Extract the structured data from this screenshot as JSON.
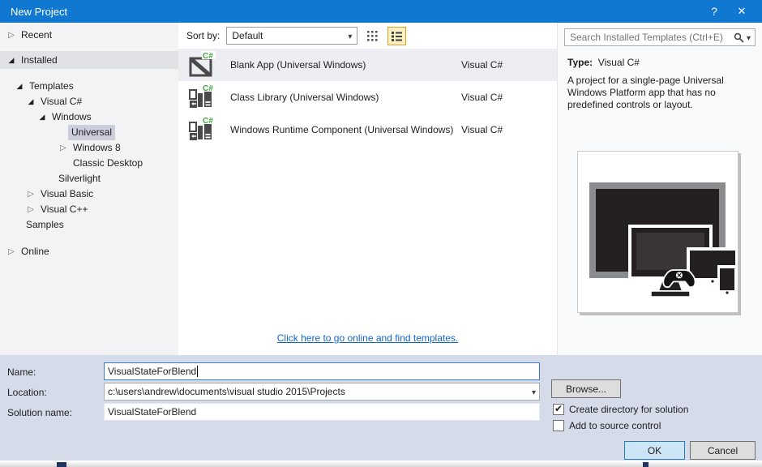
{
  "titlebar": {
    "title": "New Project",
    "help": "?",
    "close": "✕"
  },
  "sidebar": {
    "tree": [
      {
        "label": "Recent"
      },
      {
        "label": "Installed"
      },
      {
        "label": "Templates"
      },
      {
        "label": "Visual C#"
      },
      {
        "label": "Windows"
      },
      {
        "label": "Universal"
      },
      {
        "label": "Windows 8"
      },
      {
        "label": "Classic Desktop"
      },
      {
        "label": "Silverlight"
      },
      {
        "label": "Visual Basic"
      },
      {
        "label": "Visual C++"
      },
      {
        "label": "Samples"
      },
      {
        "label": "Online"
      }
    ]
  },
  "sortbar": {
    "label": "Sort by:",
    "value": "Default"
  },
  "search": {
    "placeholder": "Search Installed Templates (Ctrl+E)"
  },
  "templateList": {
    "badge": "C#",
    "items": [
      {
        "name": "Blank App (Universal Windows)",
        "language": "Visual C#"
      },
      {
        "name": "Class Library (Universal Windows)",
        "language": "Visual C#"
      },
      {
        "name": "Windows Runtime Component (Universal Windows)",
        "language": "Visual C#"
      }
    ],
    "link": "Click here to go online and find templates."
  },
  "details": {
    "type_label": "Type:",
    "type_value": "Visual C#",
    "description": "A project for a single-page Universal Windows Platform app that has no predefined controls or layout."
  },
  "footer": {
    "name_label": "Name:",
    "name_value": "VisualStateForBlend",
    "location_label": "Location:",
    "location_value": "c:\\users\\andrew\\documents\\visual studio 2015\\Projects",
    "solution_label": "Solution name:",
    "solution_value": "VisualStateForBlend",
    "browse": "Browse...",
    "checkboxes": [
      {
        "label": "Create directory for solution",
        "checked": true
      },
      {
        "label": "Add to source control",
        "checked": false
      }
    ],
    "ok": "OK",
    "cancel": "Cancel"
  },
  "colors": {
    "titlebar": "#1178d2",
    "selection": "#cccedb",
    "accent_green": "#3ba53b",
    "link": "#1166cb",
    "footer_bg": "#d6dbe9"
  }
}
